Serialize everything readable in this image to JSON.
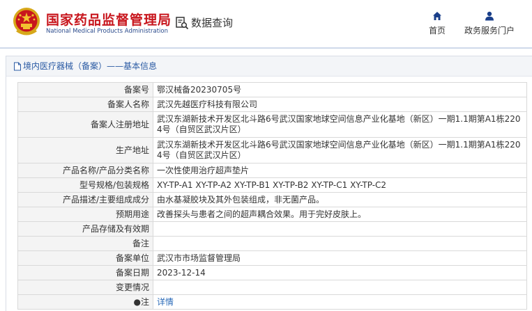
{
  "header": {
    "brand_cn": "国家药品监督管理局",
    "brand_en": "National Medical Products Administration",
    "data_query": "数据查询",
    "nav": [
      {
        "label": "首页",
        "icon": "home-icon"
      },
      {
        "label": "政务服务门户",
        "icon": "user-icon"
      }
    ]
  },
  "breadcrumb": {
    "text": "境内医疗器械（备案）",
    "suffix": "——基本信息",
    "icon": "document-icon"
  },
  "record": {
    "rows": [
      {
        "label": "备案号",
        "value": "鄂汉械备20230705号"
      },
      {
        "label": "备案人名称",
        "value": "武汉先越医疗科技有限公司"
      },
      {
        "label": "备案人注册地址",
        "value": "武汉东湖新技术开发区北斗路6号武汉国家地球空间信息产业化基地（新区）一期1.1期第A1栋2204号（自贸区武汉片区）"
      },
      {
        "label": "生产地址",
        "value": "武汉东湖新技术开发区北斗路6号武汉国家地球空间信息产业化基地（新区）一期1.1期第A1栋2204号（自贸区武汉片区）"
      },
      {
        "label": "产品名称/产品分类名称",
        "value": "一次性使用治疗超声垫片"
      },
      {
        "label": "型号规格/包装规格",
        "value": "XY-TP-A1 XY-TP-A2 XY-TP-B1 XY-TP-B2 XY-TP-C1 XY-TP-C2"
      },
      {
        "label": "产品描述/主要组成成分",
        "value": "由水基凝胶块及其外包装组成，非无菌产品。"
      },
      {
        "label": "预期用途",
        "value": "改善探头与患者之间的超声耦合效果。用于完好皮肤上。"
      },
      {
        "label": "产品存储及有效期",
        "value": ""
      },
      {
        "label": "备注",
        "value": ""
      },
      {
        "label": "备案单位",
        "value": "武汉市市场监督管理局"
      },
      {
        "label": "备案日期",
        "value": "2023-12-14"
      },
      {
        "label": "变更情况",
        "value": ""
      },
      {
        "label": "●注",
        "value": "详情"
      }
    ]
  },
  "colors": {
    "brand_red": "#c8161d",
    "brand_blue": "#2b4b8c",
    "link_blue": "#2a6ab8",
    "label_bg": "#f4f4f4"
  }
}
